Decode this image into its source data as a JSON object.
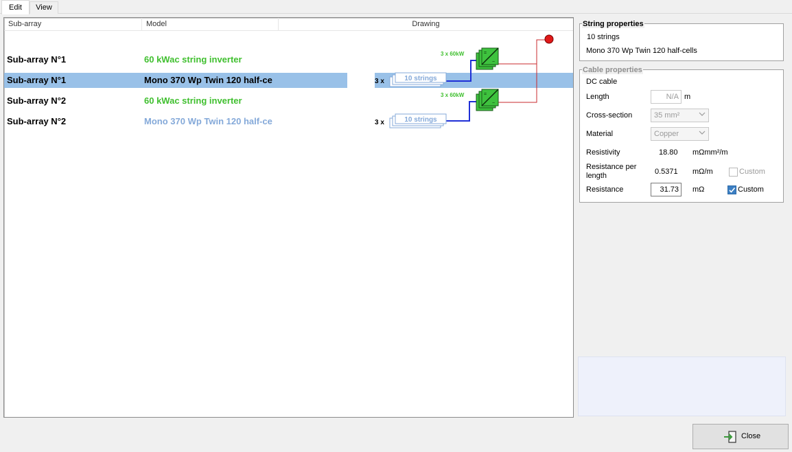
{
  "tabs": [
    {
      "label": "Edit"
    },
    {
      "label": "View"
    }
  ],
  "table": {
    "columns": [
      "Sub-array",
      "Model",
      "Drawing"
    ],
    "rows": [
      {
        "name": "Sub-array N°1",
        "model": "60 kWac string inverter"
      },
      {
        "name": "Sub-array N°1",
        "model": "Mono 370 Wp Twin 120 half-ce"
      },
      {
        "name": "Sub-array N°2",
        "model": "60 kWac string inverter"
      },
      {
        "name": "Sub-array N°2",
        "model": "Mono 370 Wp Twin 120 half-ce"
      }
    ]
  },
  "drawing": {
    "inverter_label_1": "3 x 60kW",
    "inverter_label_2": "3 x 60kW",
    "multiplier_1": "3 x",
    "multiplier_2": "3 x",
    "strings_label_1": "10 strings",
    "strings_label_2": "10 strings"
  },
  "string_properties": {
    "title": "String properties",
    "line1": "10 strings",
    "line2": "Mono 370 Wp Twin 120 half-cells"
  },
  "cable_properties": {
    "title": "Cable properties",
    "type": "DC cable",
    "length_label": "Length",
    "length_value": "N/A",
    "length_unit": "m",
    "cross_section_label": "Cross-section",
    "cross_section_value": "35 mm²",
    "material_label": "Material",
    "material_value": "Copper",
    "resistivity_label": "Resistivity",
    "resistivity_value": "18.80",
    "resistivity_unit": "mΩmm²/m",
    "rpl_label_1": "Resistance per",
    "rpl_label_2": "length",
    "rpl_value": "0.5371",
    "rpl_unit": "mΩ/m",
    "rpl_custom_label": "Custom",
    "rpl_custom_checked": false,
    "resistance_label": "Resistance",
    "resistance_value": "31.73",
    "resistance_unit": "mΩ",
    "resistance_custom_label": "Custom",
    "resistance_custom_checked": true
  },
  "close_button": {
    "label": "Close"
  },
  "colors": {
    "selection": "#99c1e8",
    "inverter_text": "#3fbf2e",
    "module_text": "#84a9d9",
    "inverter_fill": "#3ec23e",
    "dc_wire": "#1f2fd6",
    "ac_wire": "#c8282d",
    "grid_node": "#e01919"
  }
}
